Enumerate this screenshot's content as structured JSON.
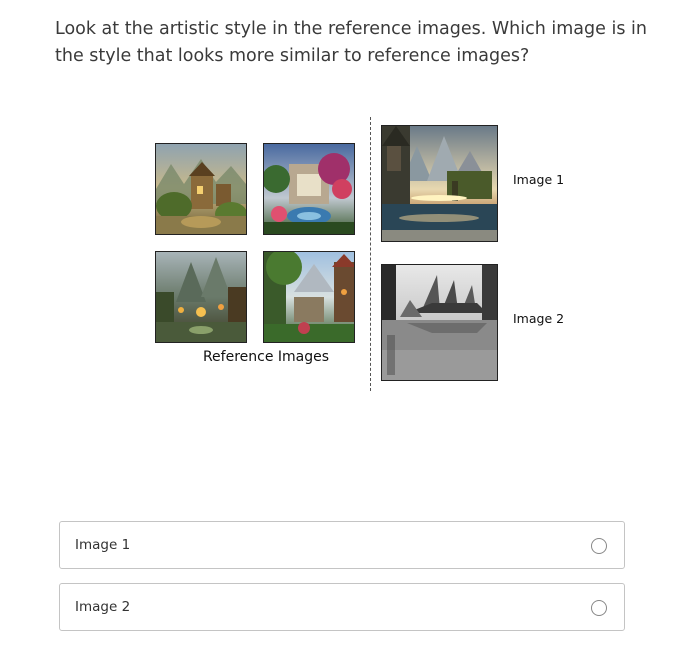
{
  "question": {
    "text": "Look at the artistic style in the reference images. Which image is in the style that looks more similar to reference images?"
  },
  "figure": {
    "reference_caption": "Reference Images",
    "candidates": [
      {
        "label": "Image 1"
      },
      {
        "label": "Image 2"
      }
    ]
  },
  "options": [
    {
      "label": "Image 1"
    },
    {
      "label": "Image 2"
    }
  ]
}
